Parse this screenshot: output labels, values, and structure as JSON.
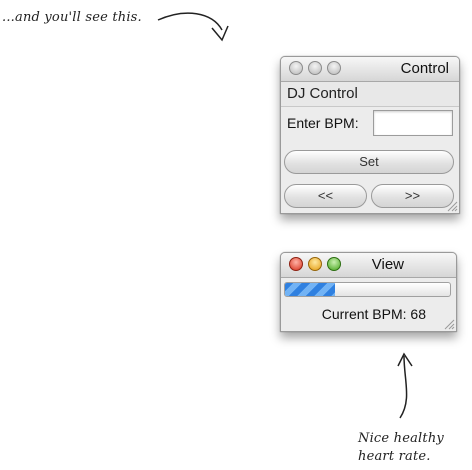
{
  "annotations": {
    "top": "...and you'll see this.",
    "bottom_line1": "Nice healthy",
    "bottom_line2": "heart rate."
  },
  "control_window": {
    "title": "Control",
    "heading": "DJ Control",
    "bpm_label": "Enter BPM:",
    "bpm_value": "",
    "set_label": "Set",
    "prev_label": "<<",
    "next_label": ">>"
  },
  "view_window": {
    "title": "View",
    "progress": 0.3,
    "current_bpm": "Current BPM: 68"
  }
}
